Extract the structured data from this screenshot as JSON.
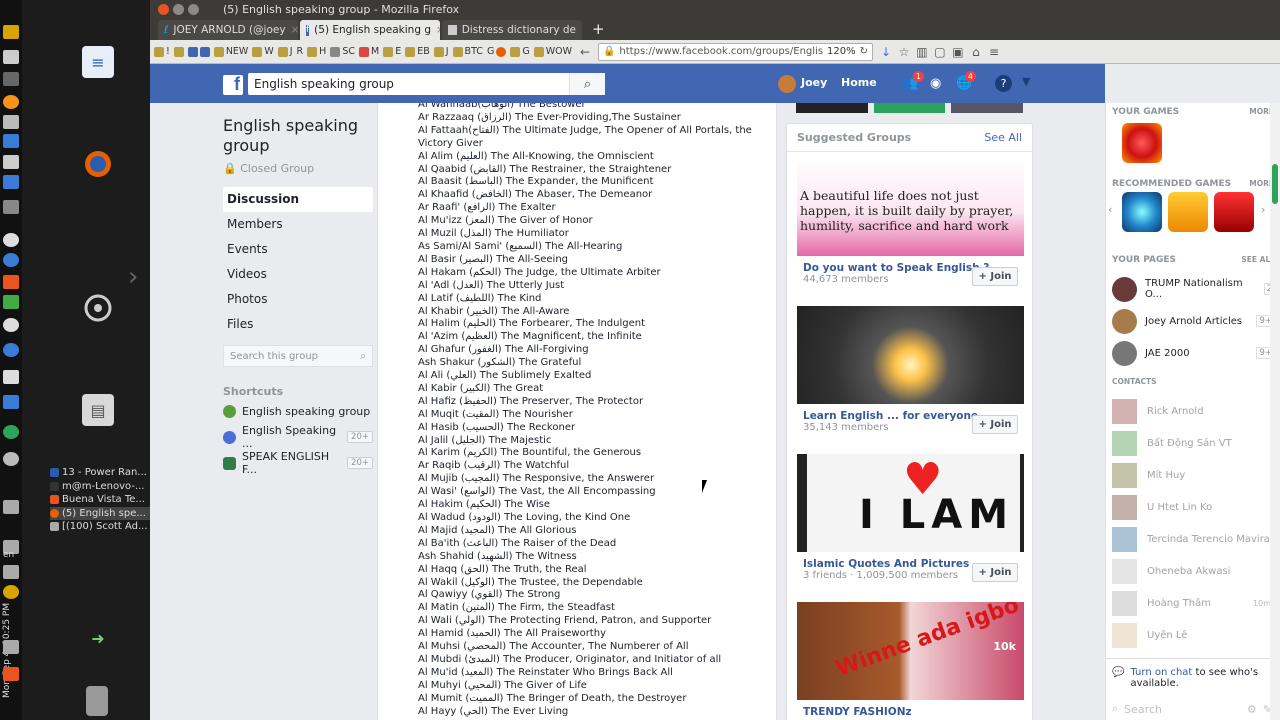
{
  "window": {
    "title": "(5) English speaking group - Mozilla Firefox"
  },
  "tabs": [
    {
      "label": "JOEY ARNOLD (@joey"
    },
    {
      "label": "(5) English speaking g"
    },
    {
      "label": "Distress dictionary de"
    }
  ],
  "bookmarks": [
    "!",
    "NEW",
    "W",
    "J",
    "R",
    "H",
    "SC",
    "M",
    "E",
    "EB",
    "J",
    "BTC",
    "G",
    "G",
    "WOW"
  ],
  "url": "https://www.facebook.com/groups/Englis",
  "zoom": "120%",
  "fb": {
    "search_value": "English speaking group",
    "user": "Joey",
    "home": "Home",
    "friend_badge": "1",
    "notif_badge": "4"
  },
  "group": {
    "title": "English speaking group",
    "privacy": "Closed Group",
    "nav": [
      "Discussion",
      "Members",
      "Events",
      "Videos",
      "Photos",
      "Files"
    ],
    "search_placeholder": "Search this group",
    "shortcuts_heading": "Shortcuts",
    "shortcuts": [
      {
        "label": "English speaking group",
        "count": ""
      },
      {
        "label": "English Speaking ...",
        "count": "20+"
      },
      {
        "label": "SPEAK ENGLISH F...",
        "count": "20+"
      }
    ]
  },
  "names": [
    "Al Wahhaab(الوهاب) The Bestower",
    "Ar Razzaaq (الرزاق) The Ever-Providing,The Sustainer",
    "Al Fattaah(الفتاح) The Ultimate Judge, The Opener of All Portals, the Victory Giver",
    "Al Alim (العليم) The All-Knowing, the Omniscient",
    "Al Qaabid (القابض) The Restrainer, the Straightener",
    "Al Baasit (الباسط) The Expander, the Munificent",
    "Al Khaafid (الخافض) The Abaser, The Demeanor",
    "Ar Raafi' (الرافع) The Exalter",
    "Al Mu'izz (المعز) The Giver of Honor",
    "Al Muzil (المذل) The Humiliator",
    "As Sami/Al Sami' (السميع) The All-Hearing",
    "Al Basir (البصير) The All-Seeing",
    "Al Hakam (الحكم) The Judge, the Ultimate Arbiter",
    "Al 'Adl (العدل) The Utterly Just",
    "Al Latif (اللطيف) The Kind",
    "Al Khabir (الخبير) The All-Aware",
    "Al Halim (الحليم) The Forbearer, The Indulgent",
    "Al 'Azim (العظيم) The Magnificent, the Infinite",
    "Al Ghafur (الغفور) The All-Forgiving",
    "Ash Shakur (الشكور) The Grateful",
    "Al Ali (العلي) The Sublimely Exalted",
    "Al Kabir (الكبير) The Great",
    "Al Hafiz (الحفيظ) The Preserver, The Protector",
    "Al Muqit (المقيت) The Nourisher",
    "Al Hasib (الحسيب) The Reckoner",
    "Al Jalil (الجليل) The Majestic",
    "Al Karim (الكريم) The Bountiful, the Generous",
    "Ar Raqib (الرقيب) The Watchful",
    "Al Mujib (المجيب) The Responsive, the Answerer",
    "Al Wasi' (الواسع) The Vast, the All Encompassing",
    "Al Hakim (الحكيم) The Wise",
    "Al Wadud (الودود) The Loving, the Kind One",
    "Al Majid (المجيد) The All Glorious",
    "Al Ba'ith (الباعث) The Raiser of the Dead",
    "Ash Shahid (الشهيد) The Witness",
    "Al Haqq (الحق) The Truth, the Real",
    "Al Wakil (الوكيل) The Trustee, the Dependable",
    "Al Qawiyy (القوي) The Strong",
    "Al Matin (المتين) The Firm, the Steadfast",
    "Al Wali (الولي) The Protecting Friend, Patron, and Supporter",
    "Al Hamid (الحميد) The All Praiseworthy",
    "Al Muhsi (المحصي) The Accounter, The Numberer of All",
    "Al Mubdi (المبدئ) The Producer, Originator, and Initiator of all",
    "Al Mu'id (المعيد) The Reinstater Who Brings Back All",
    "Al Muhyi (المحيي) The Giver of Life",
    "Al Mumit (المميت) The Bringer of Death, the Destroyer",
    "Al Hayy (الحي) The Ever Living"
  ],
  "suggested": {
    "heading": "Suggested Groups",
    "see_all": "See All",
    "join_label": "+ Join",
    "groups": [
      {
        "name": "Do you want to Speak English ?",
        "members": "44,673 members",
        "image_text": "A beautiful life does not just happen, it is built daily by prayer, humility, sacrifice and hard work"
      },
      {
        "name": "Learn English ... for everyone",
        "members": "35,143 members"
      },
      {
        "name": "Islamic Quotes And Pictures",
        "members": "3 friends · 1,009,500 members",
        "image_text": "I LAM"
      },
      {
        "name": "TRENDY FASHIONz",
        "members": "",
        "image_text": "Winne ada igbo",
        "corner": "10k"
      }
    ]
  },
  "chat": {
    "your_games": "YOUR GAMES",
    "more": "MORE",
    "recommended": "RECOMMENDED GAMES",
    "your_pages": "YOUR PAGES",
    "see_all": "SEE ALL",
    "pages": [
      {
        "name": "TRUMP Nationalism O...",
        "count": "2"
      },
      {
        "name": "Joey Arnold Articles",
        "count": "9+"
      },
      {
        "name": "JAE 2000",
        "count": "9+"
      }
    ],
    "contacts_heading": "CONTACTS",
    "contacts": [
      "Rick Arnold",
      "Bất Động Sản VT",
      "Mít Huy",
      "U Htet Lin Ko",
      "Tercinda Terencio Mavira",
      "Oheneba Akwasi",
      "Hoàng Thâm",
      "Uyên Lê"
    ],
    "contact_time": "10m",
    "turn_on_link": "Turn on chat",
    "turn_on_rest": " to see who's available.",
    "search_placeholder": "Search"
  },
  "desktop": {
    "tasks": [
      "13 - Power Ran...",
      "m@m-Lenovo-...",
      "Buena Vista Te...",
      "(5) English spe...",
      "[(100) Scott Ad..."
    ],
    "clock": "Mon Sep 4, 10:25 PM",
    "lang": "en"
  },
  "colors": {
    "fb_blue": "#4267b2",
    "link": "#365899",
    "accent_orange": "#e95420"
  }
}
